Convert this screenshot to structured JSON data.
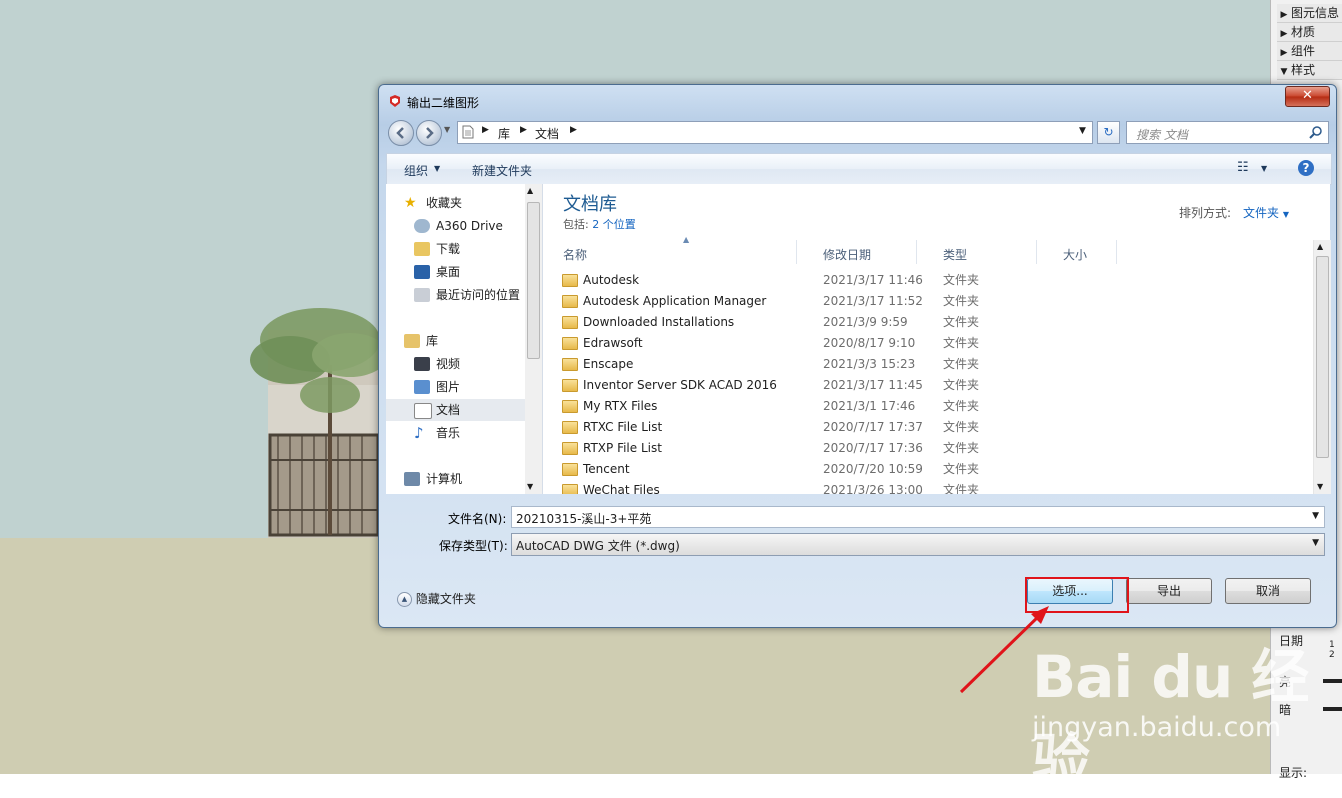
{
  "tray": {
    "items": [
      {
        "label": "图元信息",
        "expanded": false
      },
      {
        "label": "材质",
        "expanded": false
      },
      {
        "label": "组件",
        "expanded": false
      },
      {
        "label": "样式",
        "expanded": true
      }
    ],
    "date_label": "日期",
    "date_value": "1 2",
    "light_label": "亮",
    "dark_label": "暗",
    "display_label": "显示:"
  },
  "dialog": {
    "title": "输出二维图形",
    "close": "✕",
    "address": {
      "segments": [
        "库",
        "文档"
      ]
    },
    "search_placeholder": "搜索 文档",
    "toolbar": {
      "organize": "组织",
      "new_folder": "新建文件夹"
    },
    "nav": {
      "favorites": "收藏夹",
      "favorite_items": [
        "A360 Drive",
        "下载",
        "桌面",
        "最近访问的位置"
      ],
      "libraries": "库",
      "library_items": [
        "视频",
        "图片",
        "文档",
        "音乐"
      ],
      "computer": "计算机"
    },
    "library_title": "文档库",
    "library_include_label": "包括:",
    "library_include_link": "2 个位置",
    "sort_label": "排列方式:",
    "sort_value": "文件夹",
    "columns": [
      "名称",
      "修改日期",
      "类型",
      "大小"
    ],
    "files": [
      {
        "name": "Autodesk",
        "date": "2021/3/17 11:46",
        "type": "文件夹"
      },
      {
        "name": "Autodesk Application Manager",
        "date": "2021/3/17 11:52",
        "type": "文件夹"
      },
      {
        "name": "Downloaded Installations",
        "date": "2021/3/9 9:59",
        "type": "文件夹"
      },
      {
        "name": "Edrawsoft",
        "date": "2020/8/17 9:10",
        "type": "文件夹"
      },
      {
        "name": "Enscape",
        "date": "2021/3/3 15:23",
        "type": "文件夹"
      },
      {
        "name": "Inventor Server SDK ACAD 2016",
        "date": "2021/3/17 11:45",
        "type": "文件夹"
      },
      {
        "name": "My RTX Files",
        "date": "2021/3/1 17:46",
        "type": "文件夹"
      },
      {
        "name": "RTXC File List",
        "date": "2020/7/17 17:37",
        "type": "文件夹"
      },
      {
        "name": "RTXP File List",
        "date": "2020/7/17 17:36",
        "type": "文件夹"
      },
      {
        "name": "Tencent",
        "date": "2020/7/20 10:59",
        "type": "文件夹"
      },
      {
        "name": "WeChat Files",
        "date": "2021/3/26 13:00",
        "type": "文件夹"
      }
    ],
    "filename_label": "文件名(N):",
    "filename_value": "20210315-溪山-3+平苑",
    "filetype_label": "保存类型(T):",
    "filetype_value": "AutoCAD DWG 文件 (*.dwg)",
    "hide_folders": "隐藏文件夹",
    "buttons": {
      "options": "选项...",
      "export": "导出",
      "cancel": "取消"
    }
  },
  "watermark": {
    "brand": "Bai du 经验",
    "url": "jingyan.baidu.com"
  },
  "colors": {
    "highlight": "#e0141a",
    "link": "#1565c0",
    "library_title": "#1e5b92"
  }
}
